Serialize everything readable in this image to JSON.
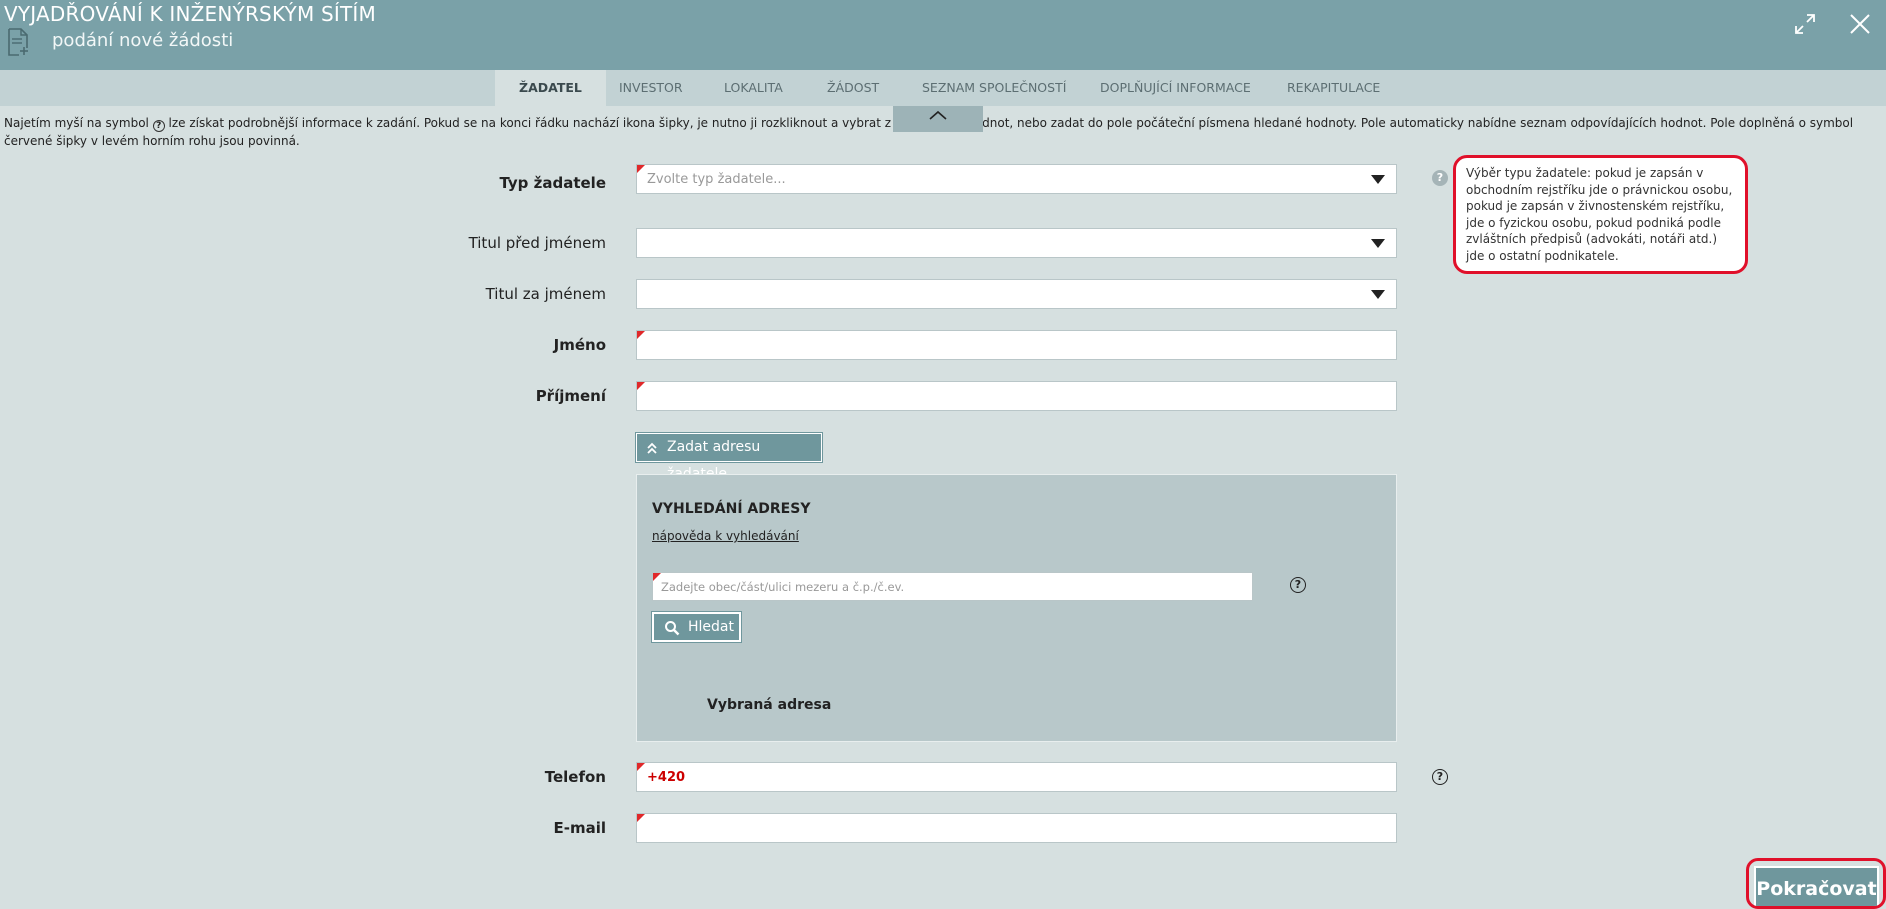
{
  "header": {
    "title": "VYJADŘOVÁNÍ K INŽENÝRSKÝM SÍTÍM",
    "subtitle": "podání nové žádosti",
    "icons": [
      "document-add-icon",
      "expand-icon",
      "close-icon"
    ]
  },
  "tabs": [
    {
      "label": "ŽADATEL",
      "active": true
    },
    {
      "label": "INVESTOR",
      "active": false
    },
    {
      "label": "LOKALITA",
      "active": false
    },
    {
      "label": "ŽÁDOST",
      "active": false
    },
    {
      "label": "SEZNAM SPOLEČNOSTÍ",
      "active": false
    },
    {
      "label": "DOPLŇUJÍCÍ INFORMACE",
      "active": false
    },
    {
      "label": "REKAPITULACE",
      "active": false
    }
  ],
  "info": {
    "before_icon": "Najetím myší na symbol",
    "icon_glyph": "?",
    "after_icon": "lze získat podrobnější informace k zadání. Pokud se na konci řádku nachází ikona šipky, je nutno ji rozkliknout a vybrat z nabízených hodnot, nebo zadat do pole počáteční písmena hledané hodnoty. Pole automaticky nabídne seznam odpovídajících hodnot. Pole doplněná o symbol červené šipky v levém horním rohu jsou povinná."
  },
  "form": {
    "typ_zadatele": {
      "label": "Typ žadatele",
      "value": "",
      "placeholder": "Zvolte typ žadatele..."
    },
    "titul_pred": {
      "label": "Titul před jménem",
      "value": ""
    },
    "titul_za": {
      "label": "Titul za jménem",
      "value": ""
    },
    "jmeno": {
      "label": "Jméno",
      "value": ""
    },
    "prijmeni": {
      "label": "Příjmení",
      "value": ""
    },
    "telefon": {
      "label": "Telefon",
      "value": "+420"
    },
    "email": {
      "label": "E-mail",
      "value": ""
    }
  },
  "tooltip": {
    "text": "Výběr typu žadatele: pokud je zapsán v obchodním rejstříku jde o právnickou osobu, pokud je zapsán v živnostenském rejstříku, jde o fyzickou osobu, pokud podniká podle zvláštních předpisů (advokáti, notáři atd.) jde o ostatní podnikatele."
  },
  "address": {
    "toggle_label": "Zadat adresu žadatele",
    "title": "VYHLEDÁNÍ ADRESY",
    "help_link": "nápověda k vyhledávání",
    "search_placeholder": "Zadejte obec/část/ulici mezeru a č.p./č.ev.",
    "search_value": "",
    "search_button": "Hledat",
    "selected_label": "Vybraná adresa"
  },
  "help_glyph": "?",
  "continue_label": "Pokračovat",
  "colors": {
    "header": "#7aa1a8",
    "tabs_bar": "#c2d2d4",
    "background": "#d6e0e0",
    "button": "#6f979d",
    "required_mark": "#e0282a",
    "highlight": "#e0102a",
    "phone_text": "#cc0000"
  }
}
